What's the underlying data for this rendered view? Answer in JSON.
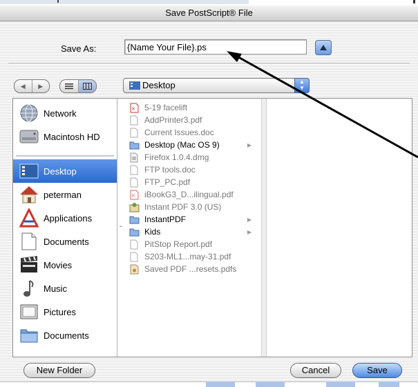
{
  "window": {
    "title": "Save PostScript® File"
  },
  "save_as": {
    "label": "Save As:",
    "value": "{Name Your File}.ps"
  },
  "location_popup": {
    "value": "Desktop"
  },
  "sidebar": {
    "items": [
      {
        "label": "Network",
        "icon": "network-globe-icon"
      },
      {
        "label": "Macintosh HD",
        "icon": "hard-drive-icon"
      },
      {
        "label": "Desktop",
        "icon": "desktop-icon",
        "selected": true
      },
      {
        "label": "peterman",
        "icon": "home-icon"
      },
      {
        "label": "Applications",
        "icon": "applications-icon"
      },
      {
        "label": "Documents",
        "icon": "documents-folder-icon"
      },
      {
        "label": "Movies",
        "icon": "clapper-icon"
      },
      {
        "label": "Music",
        "icon": "music-note-icon"
      },
      {
        "label": "Pictures",
        "icon": "pictures-icon"
      },
      {
        "label": "Documents",
        "icon": "documents-folder-icon"
      }
    ]
  },
  "files": [
    {
      "name": "5-19 facelift",
      "icon": "pdf-icon",
      "enabled": false
    },
    {
      "name": "AddPrinter3.pdf",
      "icon": "document-icon",
      "enabled": false
    },
    {
      "name": "Current Issues.doc",
      "icon": "document-icon",
      "enabled": false
    },
    {
      "name": "Desktop (Mac OS 9)",
      "icon": "folder-icon",
      "enabled": true,
      "folder": true
    },
    {
      "name": "Firefox 1.0.4.dmg",
      "icon": "disk-image-icon",
      "enabled": false
    },
    {
      "name": "FTP tools.doc",
      "icon": "document-icon",
      "enabled": false
    },
    {
      "name": "FTP_PC.pdf",
      "icon": "document-icon",
      "enabled": false
    },
    {
      "name": "iBookG3_D...ilingual.pdf",
      "icon": "pdf-icon",
      "enabled": false
    },
    {
      "name": "Instant PDF 3.0 (US)",
      "icon": "installer-icon",
      "enabled": false
    },
    {
      "name": "InstantPDF",
      "icon": "folder-icon",
      "enabled": true,
      "folder": true
    },
    {
      "name": "Kids",
      "icon": "folder-icon",
      "enabled": true,
      "folder": true
    },
    {
      "name": "PitStop Report.pdf",
      "icon": "document-icon",
      "enabled": false
    },
    {
      "name": "S203-ML1...may-31.pdf",
      "icon": "document-icon",
      "enabled": false
    },
    {
      "name": "Saved PDF ...resets.pdfs",
      "icon": "settings-file-icon",
      "enabled": false
    }
  ],
  "buttons": {
    "new_folder": "New Folder",
    "cancel": "Cancel",
    "save": "Save"
  },
  "colors": {
    "selection": "#3d7ddb",
    "accent_button": "#4e8be3",
    "annotation_arrow": "#000000"
  }
}
